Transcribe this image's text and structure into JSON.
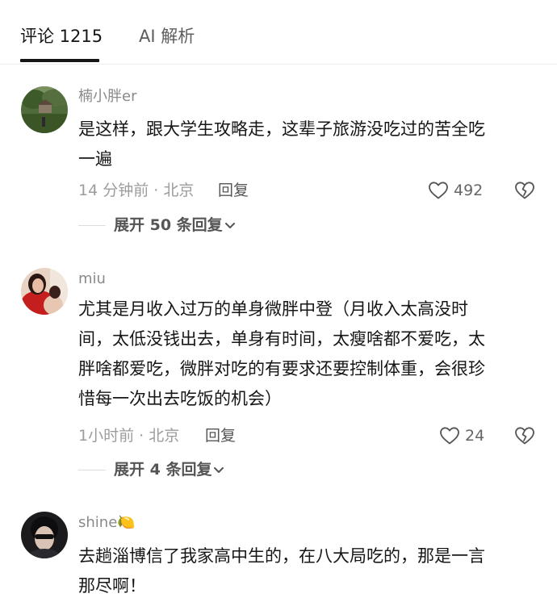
{
  "tabs": [
    {
      "label": "评论 1215",
      "active": true
    },
    {
      "label": "AI 解析",
      "active": false
    }
  ],
  "colors": {
    "text": "#161616",
    "meta": "#9c9c9c",
    "username": "#8a8a8a",
    "divider": "#ececec"
  },
  "comments": [
    {
      "username": "楠小胖er",
      "lines": [
        "是这样，跟大学生攻略走，这辈子旅游没吃过的苦全吃",
        "一遍"
      ],
      "meta": "14 分钟前 · 北京",
      "reply_label": "回复",
      "likes": "492",
      "expand_label": "展开 50 条回复"
    },
    {
      "username": "miu",
      "lines": [
        "尤其是月收入过万的单身微胖中登（月收入太高没时",
        "间，太低没钱出去，单身有时间，太瘦啥都不爱吃，太",
        "胖啥都爱吃，微胖对吃的有要求还要控制体重，会很珍",
        "惜每一次出去吃饭的机会）"
      ],
      "meta": "1小时前 · 北京",
      "reply_label": "回复",
      "likes": "24",
      "expand_label": "展开 4 条回复"
    },
    {
      "username": "shine",
      "username_emoji": "🍋",
      "lines": [
        "去趟淄博信了我家高中生的，在八大局吃的，那是一言",
        "那尽啊！"
      ]
    }
  ]
}
